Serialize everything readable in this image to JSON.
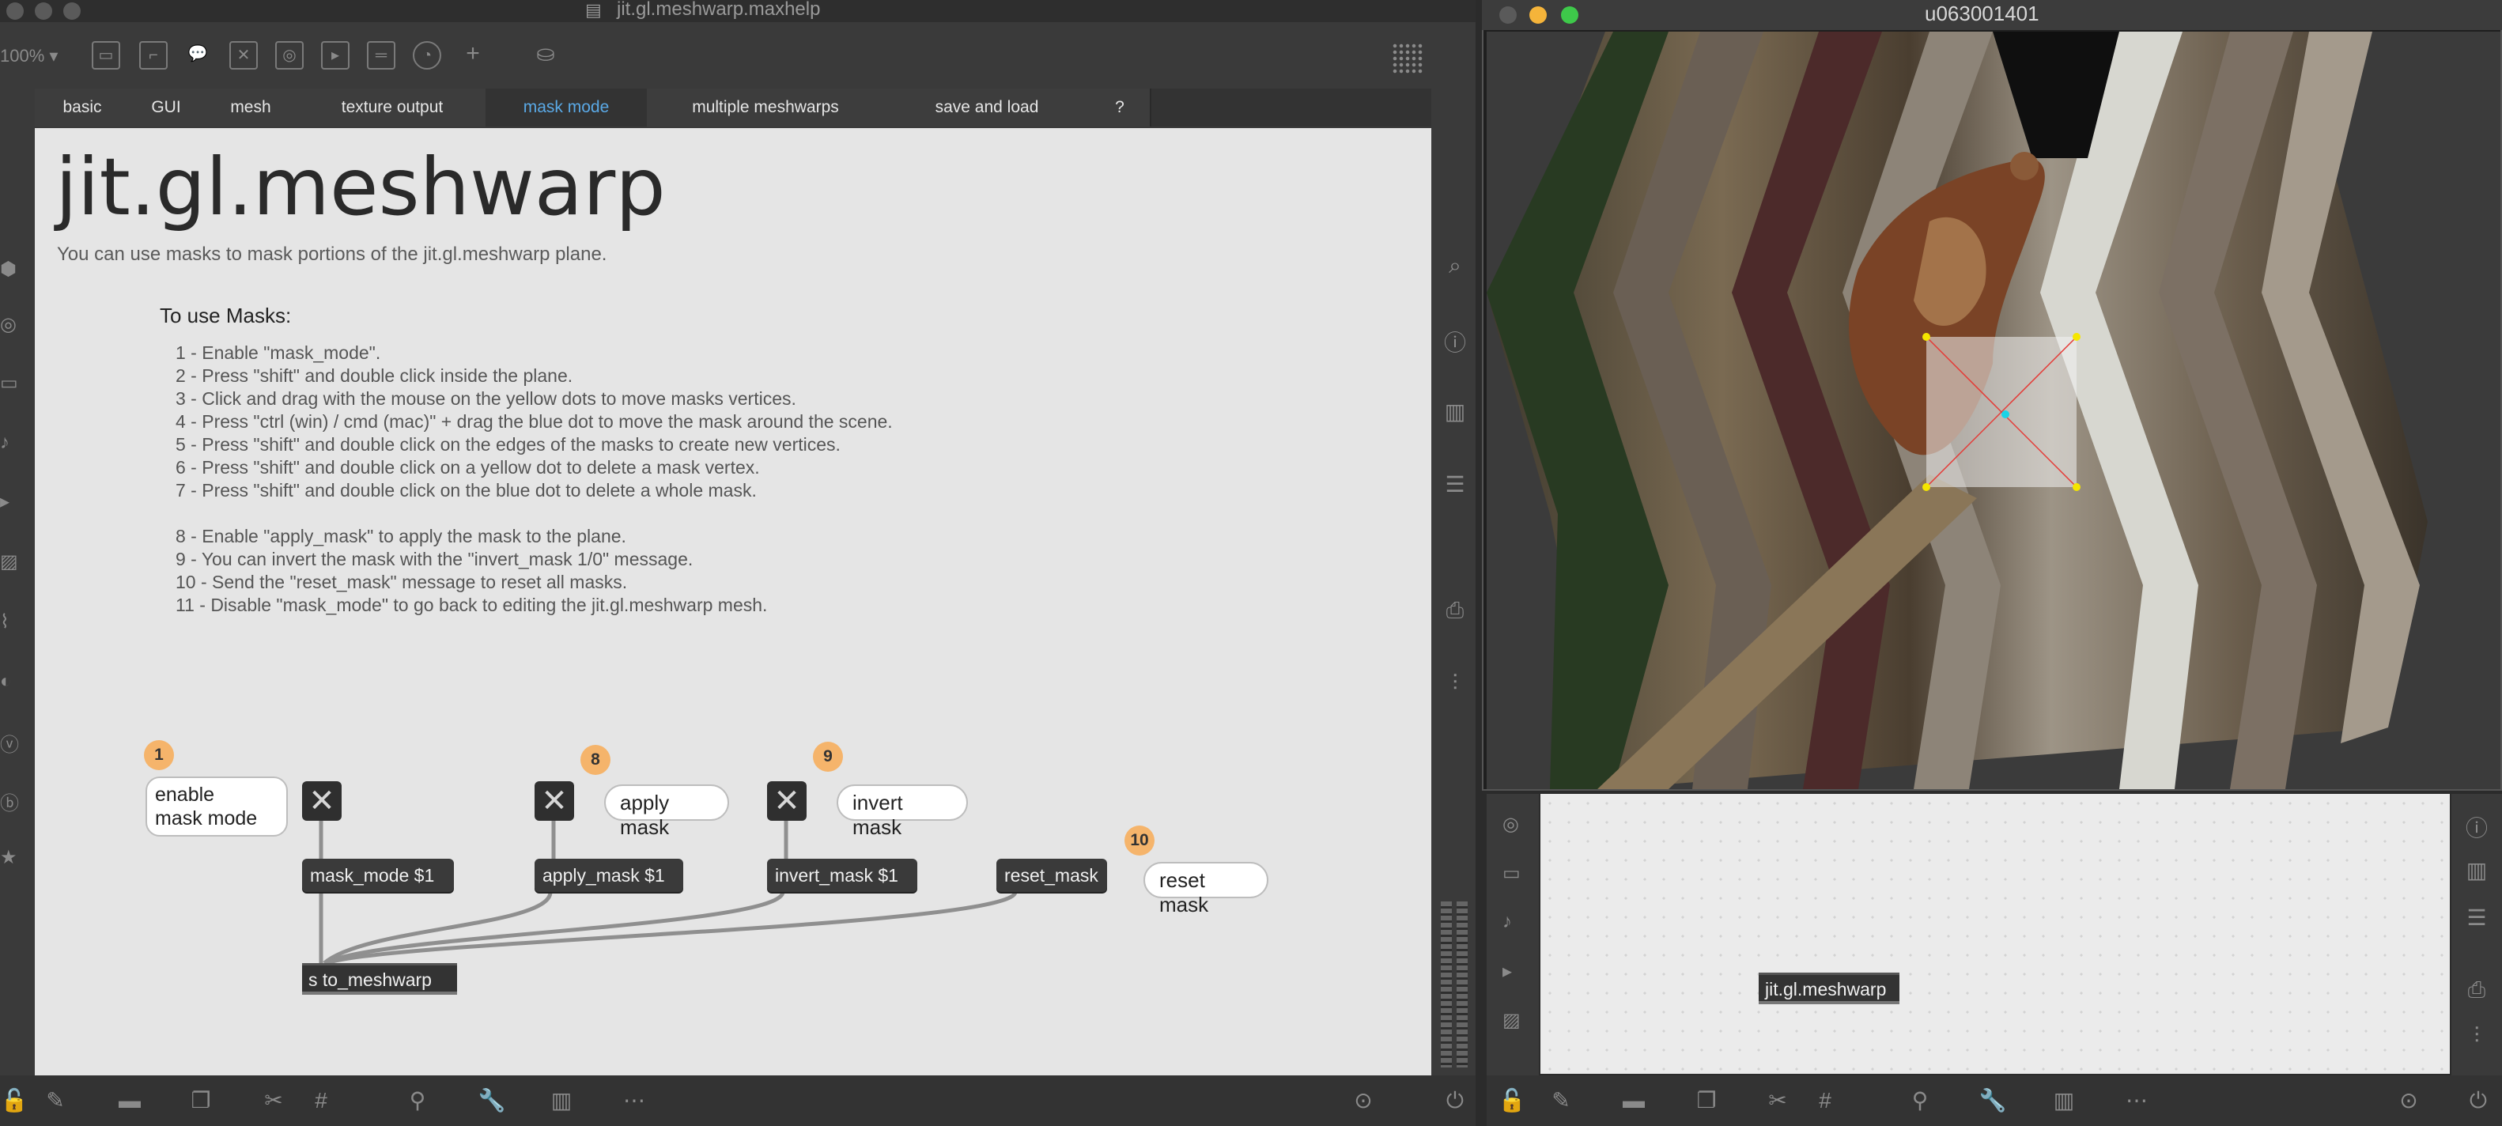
{
  "left_window": {
    "title": "jit.gl.meshwarp.maxhelp",
    "zoom": "100%",
    "tabs": [
      {
        "label": "basic"
      },
      {
        "label": "GUI"
      },
      {
        "label": "mesh"
      },
      {
        "label": "texture output"
      },
      {
        "label": "mask mode"
      },
      {
        "label": "multiple meshwarps"
      },
      {
        "label": "save and load"
      },
      {
        "label": "?"
      }
    ],
    "active_tab": "mask mode",
    "title_text": "jit.gl.meshwarp",
    "description": "You can use masks to mask portions of the jit.gl.meshwarp plane.",
    "instructions_heading": "To use Masks:",
    "instructions": [
      "1 - Enable \"mask_mode\".",
      "2 - Press \"shift\" and double click inside the plane.",
      "3 - Click and drag with the mouse on the yellow dots to move masks vertices.",
      "4 - Press \"ctrl (win) / cmd (mac)\" + drag the blue dot to move the mask around the scene.",
      "5 - Press \"shift\" and double click on the edges of the masks to create new vertices.",
      "6 - Press \"shift\" and double click on a yellow dot to delete a mask vertex.",
      "7 - Press \"shift\" and double click on the blue dot to delete a whole mask.",
      "",
      "8 - Enable \"apply_mask\" to apply the mask to the plane.",
      "9 - You can invert the mask with the \"invert_mask 1/0\" message.",
      "10 - Send the \"reset_mask\" message to reset all masks.",
      "11 - Disable \"mask_mode\" to go back to editing the jit.gl.meshwarp mesh."
    ],
    "patch": {
      "steps": [
        "1",
        "8",
        "9",
        "10"
      ],
      "comments": {
        "enable_mask_mode": "enable\nmask mode",
        "apply_mask": "apply mask",
        "invert_mask": "invert mask",
        "reset_mask": "reset mask"
      },
      "messages": {
        "mask_mode": "mask_mode $1",
        "apply_mask": "apply_mask $1",
        "invert_mask": "invert_mask $1",
        "reset_mask": "reset_mask"
      },
      "send_object": "s to_meshwarp",
      "toggle_glyph": "✕"
    }
  },
  "right_window": {
    "title": "u063001401",
    "object": "jit.gl.meshwarp"
  },
  "colors": {
    "accent_tab": "#5aa9e6",
    "step_badge": "#f5b46b",
    "mask_vertex": "#f5e600",
    "mask_center": "#19d3e6"
  }
}
